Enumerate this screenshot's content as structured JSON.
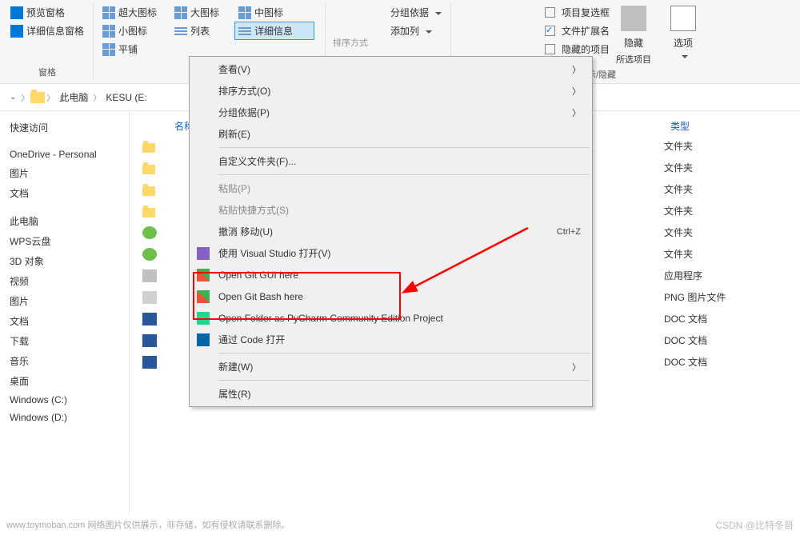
{
  "ribbon": {
    "panes": {
      "preview": "预览窗格",
      "details_pane": "详细信息窗格",
      "panes_label": "窗格"
    },
    "layout": {
      "extra_large": "超大图标",
      "large": "大图标",
      "medium": "中图标",
      "small": "小图标",
      "list": "列表",
      "details": "详细信息",
      "tiles": "平铺"
    },
    "view": {
      "sort": "排序方式",
      "group_by": "分组依据",
      "add_columns": "添加列"
    },
    "showhide": {
      "item_checkboxes": "项目复选框",
      "file_ext": "文件扩展名",
      "hidden_items": "隐藏的项目",
      "hide": "隐藏",
      "hide_sub": "所选项目",
      "label": "显示/隐藏"
    },
    "options": "选项"
  },
  "breadcrumb": {
    "this_pc": "此电脑",
    "drive": "KESU (E:"
  },
  "nav": {
    "items": [
      "快速访问",
      "OneDrive - Personal",
      "图片",
      "文档",
      "此电脑",
      "WPS云盘",
      "3D 对象",
      "视频",
      "图片",
      "文档",
      "下载",
      "音乐",
      "桌面",
      "Windows (C:)",
      "Windows (D:)"
    ]
  },
  "columns": {
    "name": "名称",
    "type": "类型"
  },
  "types": [
    "文件夹",
    "文件夹",
    "文件夹",
    "文件夹",
    "文件夹",
    "文件夹",
    "应用程序",
    "PNG 图片文件",
    "DOC 文档",
    "DOC 文档",
    "DOC 文档"
  ],
  "context_menu": {
    "view": "查看(V)",
    "sort": "排序方式(O)",
    "group": "分组依据(P)",
    "refresh": "刷新(E)",
    "customize": "自定义文件夹(F)...",
    "paste": "粘贴(P)",
    "paste_shortcut": "粘贴快捷方式(S)",
    "undo_move": "撤消 移动(U)",
    "undo_shortcut": "Ctrl+Z",
    "open_vs": "使用 Visual Studio 打开(V)",
    "git_gui": "Open Git GUI here",
    "git_bash": "Open Git Bash here",
    "pycharm": "Open Folder as PyCharm Community Edition Project",
    "open_code": "通过 Code 打开",
    "new": "新建(W)",
    "properties": "属性(R)"
  },
  "footer": {
    "watermark": "www.toymoban.com 网络图片仅供展示，非存储，如有侵权请联系删除。",
    "csdn": "CSDN @比特冬哥"
  }
}
